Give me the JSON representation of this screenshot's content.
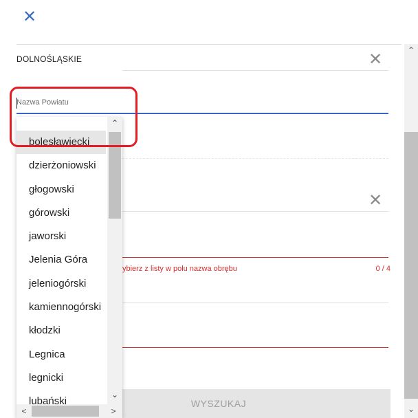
{
  "header": {
    "close_glyph": "✕",
    "close_icon": "close-icon"
  },
  "section": {
    "region_label": "DOLNOŚLĄSKIE",
    "clear_glyph": "✕"
  },
  "powiat_input": {
    "placeholder": "Nazwa Powiatu",
    "value": ""
  },
  "second_section": {
    "clear_glyph": "✕"
  },
  "obreb_field": {
    "hint": "ybierz z listy w polu nazwa obrębu",
    "counter": "0 / 4"
  },
  "search_button": {
    "label": "WYSZUKAJ"
  },
  "dropdown": {
    "items": [
      "bolesławiecki",
      "dzierżoniowski",
      "głogowski",
      "górowski",
      "jaworski",
      "Jelenia Góra",
      "jeleniogórski",
      "kamiennogórski",
      "kłodzki",
      "Legnica",
      "legnicki",
      "lubański"
    ],
    "active_index": 0,
    "up_glyph": "⌃",
    "down_glyph": "⌄",
    "left_glyph": "<",
    "right_glyph": ">"
  },
  "scrollbar": {
    "up_glyph": "⌃",
    "down_glyph": "⌄"
  },
  "colors": {
    "accent": "#3d63c9",
    "error": "#d32f2f",
    "highlight": "#e41d23"
  }
}
